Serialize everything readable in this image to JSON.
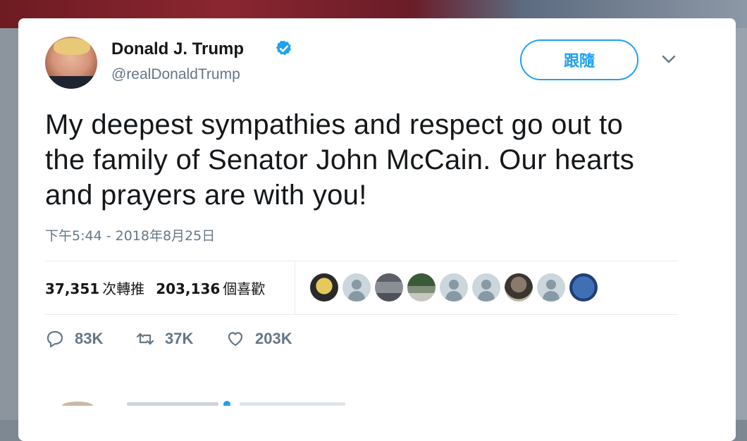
{
  "tweet": {
    "author_name": "Donald J. Trump",
    "handle": "@realDonaldTrump",
    "follow_label": "跟隨",
    "text_lines": [
      "My deepest sympathies and respect go out to",
      "the family of Senator John McCain. Our hearts",
      "and prayers are with you!"
    ],
    "timestamp": "下午5:44 - 2018年8月25日",
    "retweets_count": "37,351",
    "retweets_label": "次轉推",
    "likes_count": "203,136",
    "likes_label": "個喜歡",
    "actions": {
      "reply_count": "83K",
      "retweet_count": "37K",
      "like_count": "203K"
    }
  },
  "colors": {
    "accent": "#1da1f2",
    "text": "#14171a",
    "muted": "#657786",
    "divider": "#e6ecf0"
  },
  "icons": {
    "verified": "verified-badge-icon",
    "caret": "chevron-down-icon",
    "reply": "reply-icon",
    "retweet": "retweet-icon",
    "like": "heart-icon"
  }
}
